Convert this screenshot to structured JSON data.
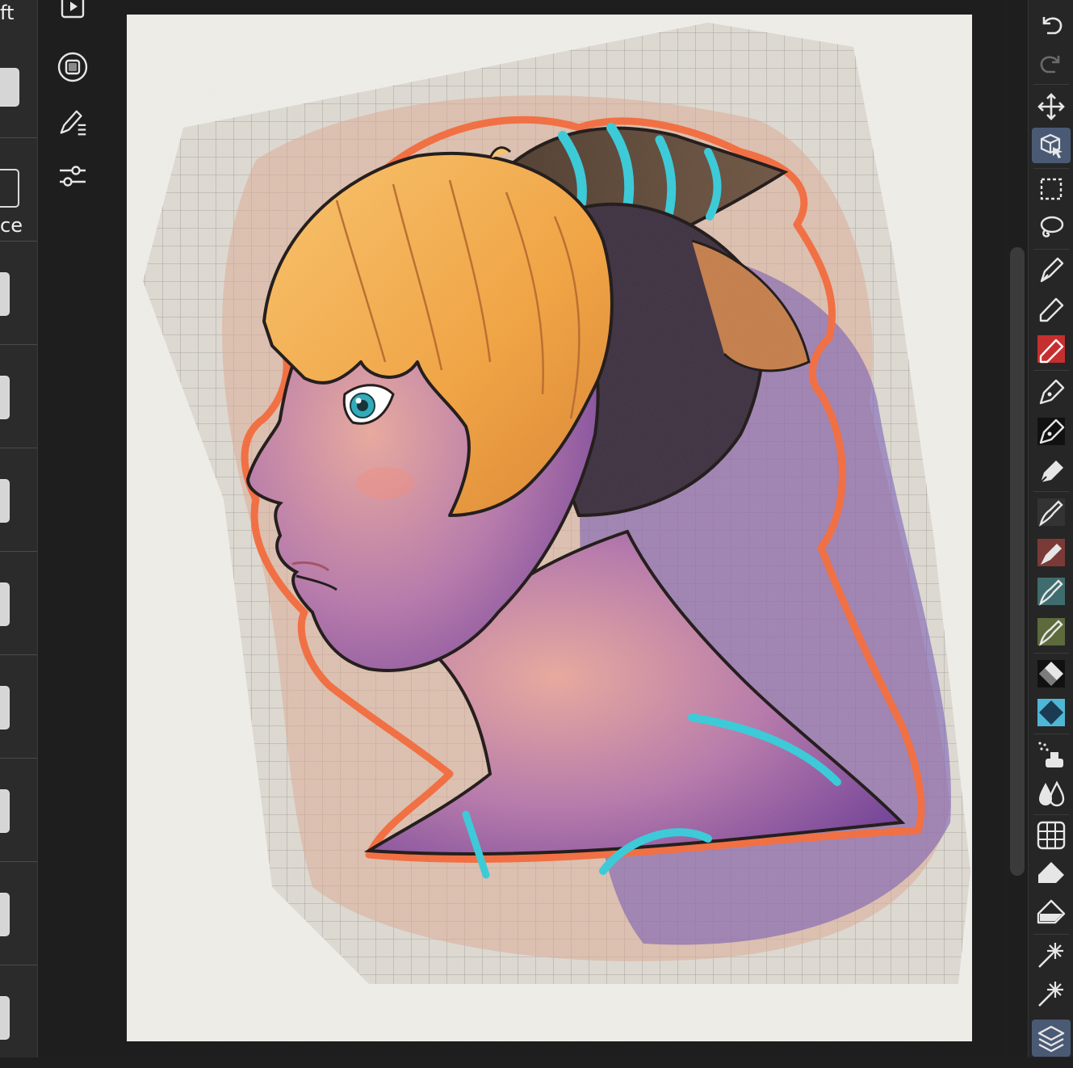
{
  "left_panel": {
    "labels": {
      "top": "ft",
      "middle": "ce"
    }
  },
  "tool_column": {
    "buttons": [
      {
        "icon": "play-frame-icon"
      },
      {
        "icon": "record-stop-icon"
      },
      {
        "icon": "brush-settings-icon"
      },
      {
        "icon": "adjustment-sliders-icon"
      }
    ]
  },
  "right_toolbar": {
    "tools": [
      {
        "icon": "undo-icon"
      },
      {
        "icon": "redo-icon"
      },
      {
        "icon": "move-icon"
      },
      {
        "icon": "transform-3d-icon",
        "active": true
      },
      {
        "icon": "rect-select-icon"
      },
      {
        "icon": "lasso-select-icon"
      },
      {
        "icon": "pen-icon"
      },
      {
        "icon": "marker-icon"
      },
      {
        "icon": "red-marker-icon"
      },
      {
        "icon": "ink-pen-icon"
      },
      {
        "icon": "dark-pen-icon"
      },
      {
        "icon": "chisel-pen-icon"
      },
      {
        "icon": "brush-dark-icon"
      },
      {
        "icon": "brush-red-icon"
      },
      {
        "icon": "brush-teal-icon"
      },
      {
        "icon": "brush-green-icon"
      },
      {
        "icon": "eraser-icon"
      },
      {
        "icon": "blue-eraser-icon"
      },
      {
        "icon": "airbrush-icon"
      },
      {
        "icon": "blend-drops-icon"
      },
      {
        "icon": "grid-icon"
      },
      {
        "icon": "fill-bucket-icon"
      },
      {
        "icon": "fill-bucket-outline-icon"
      },
      {
        "icon": "magic-wand-icon"
      },
      {
        "icon": "magic-wand-alt-icon"
      },
      {
        "icon": "layers-icon",
        "active": true
      }
    ]
  },
  "colors": {
    "background": "#1f1f1f",
    "paper": "#ecebe6",
    "outline_orange": "#f06a3c",
    "hair": "#f1a545",
    "horn_stripe": "#35c8d6",
    "skin_purple": "#8e5aa8",
    "active_tool": "#4a5a75"
  }
}
